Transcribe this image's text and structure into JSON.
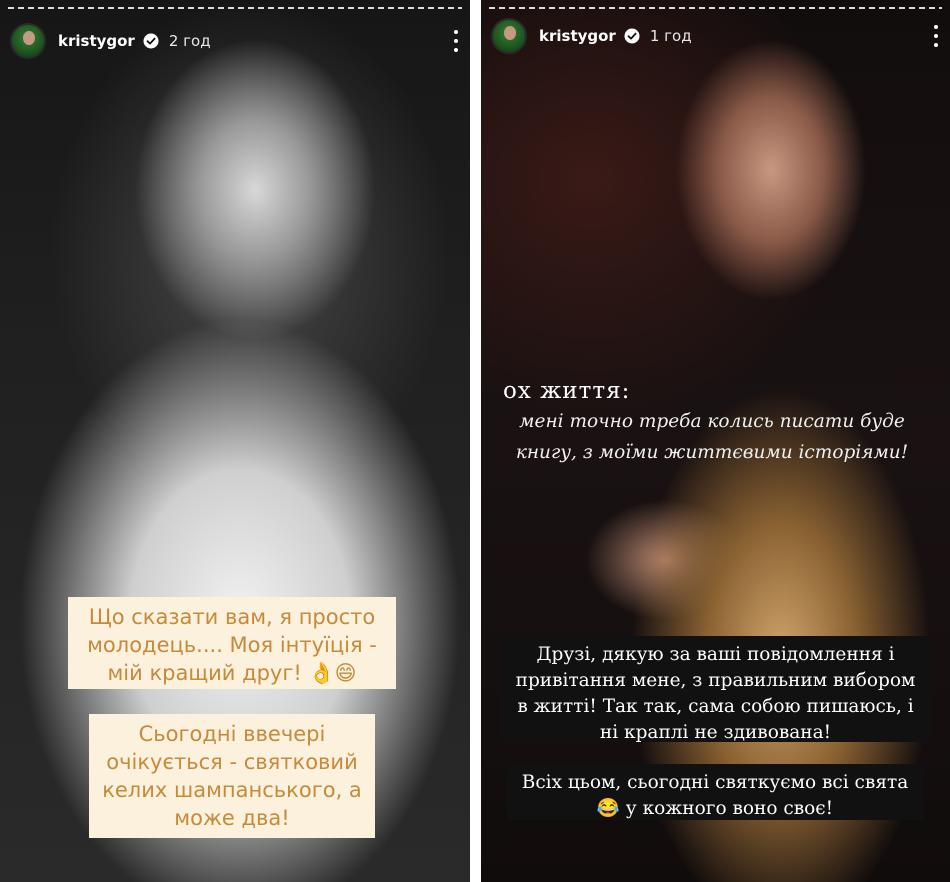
{
  "stories": [
    {
      "username": "kristygor",
      "time": "2 год",
      "captions": [
        "Що сказати вам, я просто молодець.... Моя інтуїція - мій кращий друг! 👌😄",
        "Сьогодні ввечері очікується - святковий келих шампанського, а може два!"
      ]
    },
    {
      "username": "kristygor",
      "time": "1 год",
      "heading": "ох життя:",
      "subtext_line1": "мені точно треба колись писати буде",
      "subtext_line2": "книгу, з моїми життєвими історіями!",
      "captions": [
        "Друзі, дякую за ваші повідомлення і привітання мене, з правильним вибором в житті! Так так, сама собою пишаюсь, і ні краплі не здивована!",
        "Всіх цьом, сьогодні святкуємо всі свята 😂 у кожного воно своє!"
      ]
    }
  ],
  "icons": {
    "verified": "verified-badge-icon",
    "more": "more-options-icon"
  },
  "colors": {
    "caption_beige_bg": "#fbf1dd",
    "caption_beige_text": "#c7893a",
    "caption_dark_bg": "#111111"
  }
}
